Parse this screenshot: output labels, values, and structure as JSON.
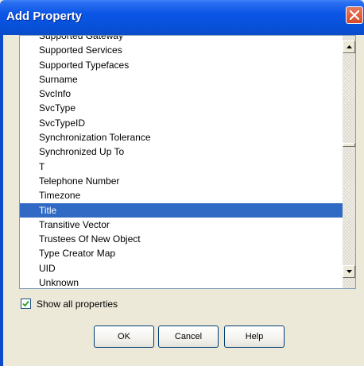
{
  "window": {
    "title": "Add Property"
  },
  "list": {
    "items": [
      "Supported Gateway",
      "Supported Services",
      "Supported Typefaces",
      "Surname",
      "SvcInfo",
      "SvcType",
      "SvcTypeID",
      "Synchronization Tolerance",
      "Synchronized Up To",
      "T",
      "Telephone Number",
      "Timezone",
      "Title",
      "Transitive Vector",
      "Trustees Of New Object",
      "Type Creator Map",
      "UID",
      "Unknown"
    ],
    "selected": "Title"
  },
  "options": {
    "show_all_label": "Show all properties",
    "show_all_checked": true
  },
  "buttons": {
    "ok": "OK",
    "cancel": "Cancel",
    "help": "Help"
  },
  "icons": {
    "close": "close-icon",
    "scroll_up": "up-arrow-icon",
    "scroll_down": "down-arrow-icon",
    "check": "checkmark-icon"
  }
}
